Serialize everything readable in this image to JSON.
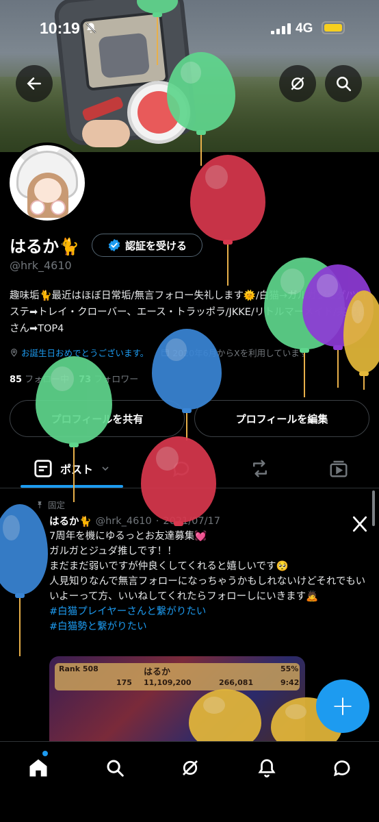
{
  "status_bar": {
    "time": "10:19",
    "network": "4G",
    "icons": [
      "bell-off-icon",
      "signal-icon",
      "battery-icon"
    ],
    "battery_color": "#f7cf1e"
  },
  "header": {
    "back_icon": "arrow-left-icon",
    "grok_icon": "grok-icon",
    "search_icon": "search-icon"
  },
  "profile": {
    "name": "はるか🐈",
    "verify_label": "認証を受ける",
    "handle": "@hrk_4610",
    "bio": "趣味垢🐈最近はほぼ日常垢/無言フォロー失礼します🌞/白猫→ガルガジュダ/ツイステ➡トレイ・クローバー、エース・トラッポラ/JKKE/リトルマーメイド/実況者さん➡TOP4",
    "birthday": "お誕生日おめでとうございます。",
    "joined": "2020年6月からXを利用しています",
    "following_count": "85",
    "following_label": "フォロー中",
    "followers_count": "73",
    "followers_label": "フォロワー",
    "share_button": "プロフィールを共有",
    "edit_button": "プロフィールを編集"
  },
  "tabs": {
    "posts_label": "ポスト",
    "icons": [
      "posts-icon",
      "chevron-down-icon",
      "chat-bubble-icon",
      "retweet-icon",
      "media-icon"
    ]
  },
  "tweet": {
    "pinned_label": "固定",
    "name": "はるか🐈",
    "handle": "@hrk_4610",
    "date": "2021/07/17",
    "lines": [
      "7周年を機にゆるっとお友達募集💓",
      "ガルガとジュダ推しです！！",
      "まだまだ弱いですが仲良くしてくれると嬉しいです🥺",
      "人見知りなんで無言フォローになっちゃうかもしれないけどそれでもいいよーって方、いいねしてくれたらフォローしにいきます🙇"
    ],
    "hashtags": [
      "#白猫プレイヤーさんと繋がりたい",
      "#白猫勢と繋がりたい"
    ],
    "media": {
      "rank_label": "Rank 508",
      "player_name": "はるか",
      "stat1": "175",
      "stat2": "11,109,200",
      "stat3": "266,081",
      "percent": "55%",
      "clock": "9:42"
    }
  },
  "fab_label": "+",
  "bottom_nav": [
    "home-icon",
    "search-icon",
    "grok-icon",
    "notifications-icon",
    "messages-icon"
  ],
  "colors": {
    "accent": "#1d9bf0",
    "balloon_green": "#5fd68d",
    "balloon_red": "#d8384e",
    "balloon_blue": "#3a86d6",
    "balloon_purple": "#8e3bd6",
    "balloon_yellow": "#e4b83a"
  }
}
